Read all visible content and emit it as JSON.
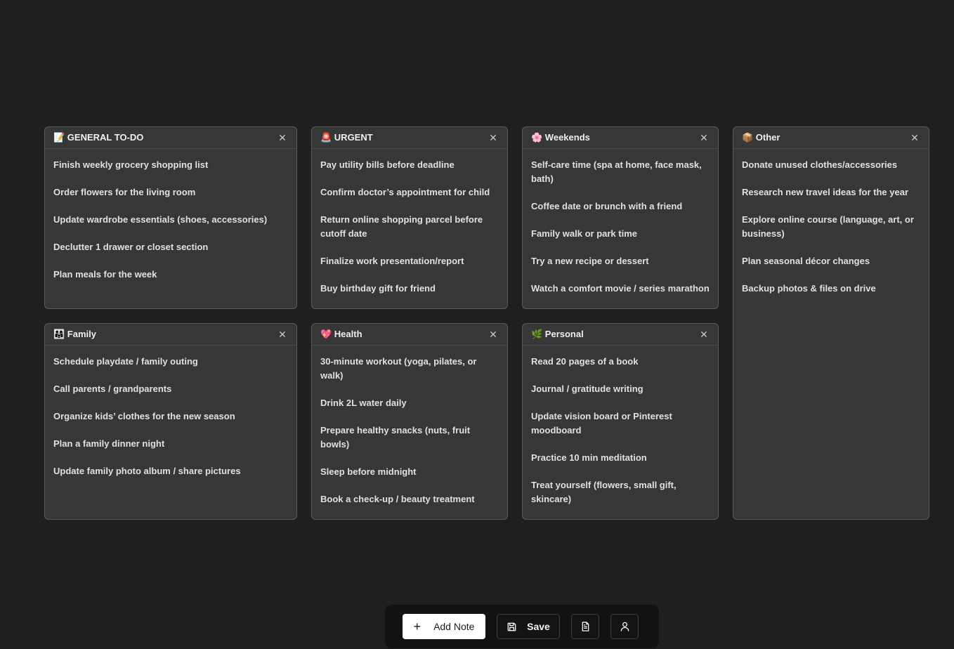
{
  "notes": [
    {
      "id": "general",
      "title": "📝 GENERAL TO-DO",
      "items": [
        "Finish weekly grocery shopping list",
        "Order flowers for the living room",
        "Update wardrobe essentials (shoes, accessories)",
        "Declutter 1 drawer or closet section",
        "Plan meals for the week"
      ]
    },
    {
      "id": "urgent",
      "title": "🚨 URGENT",
      "items": [
        "Pay utility bills before deadline",
        "Confirm doctor’s appointment for child",
        "Return online shopping parcel before cutoff date",
        "Finalize work presentation/report",
        "Buy birthday gift for friend"
      ]
    },
    {
      "id": "weekends",
      "title": "🌸 Weekends",
      "items": [
        "Self-care time (spa at home, face mask, bath)",
        "Coffee date or brunch with a friend",
        "Family walk or park time",
        "Try a new recipe or dessert",
        "Watch a comfort movie / series marathon"
      ]
    },
    {
      "id": "other",
      "title": "📦 Other",
      "items": [
        "Donate unused clothes/accessories",
        "Research new travel ideas for the year",
        "Explore online course (language, art, or business)",
        "Plan seasonal décor changes",
        "Backup photos & files on drive"
      ]
    },
    {
      "id": "family",
      "title": "👨‍👩‍👧 Family",
      "items": [
        "Schedule playdate / family outing",
        "Call parents / grandparents",
        "Organize kids’ clothes for the new season",
        "Plan a family dinner night",
        "Update family photo album / share pictures"
      ]
    },
    {
      "id": "health",
      "title": "💖 Health",
      "items": [
        "30-minute workout (yoga, pilates, or walk)",
        "Drink 2L water daily",
        "Prepare healthy snacks (nuts, fruit bowls)",
        "Sleep before midnight",
        "Book a check-up / beauty treatment"
      ]
    },
    {
      "id": "personal",
      "title": "🌿 Personal",
      "items": [
        "Read 20 pages of a book",
        "Journal / gratitude writing",
        "Update vision board or Pinterest moodboard",
        "Practice 10 min meditation",
        "Treat yourself (flowers, small gift, skincare)"
      ]
    }
  ],
  "close_glyph": "✕",
  "toolbar": {
    "add_note_icon": "plus-icon",
    "add_note_label": "Add Note",
    "save_icon": "save-icon",
    "save_label": "Save",
    "document_icon": "document-icon",
    "profile_icon": "user-icon"
  }
}
